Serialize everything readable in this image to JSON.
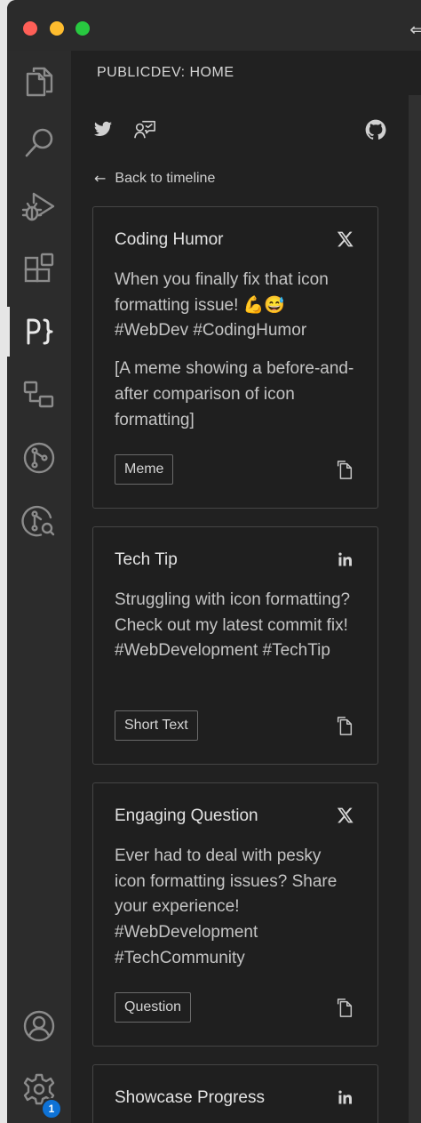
{
  "title_edge_glyph": "⇐",
  "sidebar": {
    "title": "PUBLICDEV: HOME",
    "back_label": "Back to timeline"
  },
  "accounts": {
    "badge_count": "1"
  },
  "cards": [
    {
      "title": "Coding Humor",
      "platform": "x-icon",
      "paragraphs": [
        "When you finally fix that icon formatting issue! 💪😅 #WebDev #CodingHumor",
        "[A meme showing a before-and-after comparison of icon formatting]"
      ],
      "tag": "Meme"
    },
    {
      "title": "Tech Tip",
      "platform": "linkedin-icon",
      "paragraphs": [
        "Struggling with icon formatting? Check out my latest commit fix! #WebDevelopment #TechTip"
      ],
      "tag": "Short Text"
    },
    {
      "title": "Engaging Question",
      "platform": "x-icon",
      "paragraphs": [
        "Ever had to deal with pesky icon formatting issues? Share your experience! #WebDevelopment #TechCommunity"
      ],
      "tag": "Question"
    },
    {
      "title": "Showcase Progress",
      "platform": "linkedin-icon",
      "paragraphs": [],
      "tag": ""
    }
  ],
  "colors": {
    "accent_badge": "#0e72d6",
    "sidebar_bg": "#212121",
    "activity_bg": "#2c2c2c"
  }
}
